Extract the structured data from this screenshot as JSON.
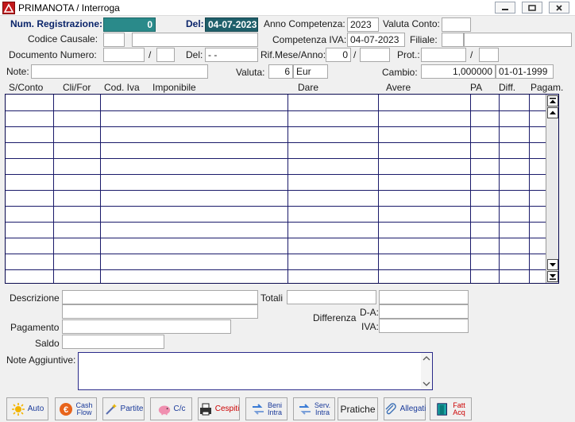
{
  "window": {
    "title": "PRIMANOTA / Interroga"
  },
  "header": {
    "num_registrazione_label": "Num. Registrazione:",
    "num_registrazione_value": "0",
    "del_label": "Del:",
    "del_value": "04-07-2023",
    "anno_competenza_label": "Anno Competenza:",
    "anno_competenza_value": "2023",
    "valuta_conto_label": "Valuta Conto:",
    "valuta_conto_value": "",
    "codice_causale_label": "Codice Causale:",
    "codice_causale_code": "",
    "codice_causale_desc": "",
    "competenza_iva_label": "Competenza IVA:",
    "competenza_iva_value": "04-07-2023",
    "filiale_label": "Filiale:",
    "filiale_code": "",
    "filiale_desc": "",
    "documento_numero_label": "Documento Numero:",
    "documento_numero_value": "",
    "documento_sep": "/",
    "documento_suffix": "",
    "doc_del_label": "Del:",
    "doc_del_value": "- -",
    "rif_mese_anno_label": "Rif.Mese/Anno:",
    "rif_mese_value": "0",
    "rif_sep": "/",
    "rif_anno_value": "",
    "prot_label": "Prot.:",
    "prot_value": "",
    "prot_sep": "/",
    "prot_suffix": "",
    "note_label": "Note:",
    "note_value": "",
    "valuta_label": "Valuta:",
    "valuta_code": "6",
    "valuta_name": "Eur",
    "cambio_label": "Cambio:",
    "cambio_value": "1,000000",
    "cambio_date": "01-01-1999"
  },
  "grid": {
    "columns": [
      "S/Conto",
      "Cli/For",
      "Cod. Iva",
      "Imponibile",
      "Dare",
      "Avere",
      "PA",
      "Diff.",
      "Pagam."
    ],
    "row_count": 12
  },
  "footer": {
    "descrizione_label": "Descrizione",
    "descrizione_1": "",
    "descrizione_2": "",
    "totali_label": "Totali",
    "totali_dare": "",
    "totali_avere": "",
    "differenza_label": "Differenza",
    "da_label": "D-A:",
    "da_value": "",
    "iva_label": "IVA:",
    "iva_value": "",
    "pagamento_label": "Pagamento",
    "pagamento_value": "",
    "saldo_label": "Saldo",
    "saldo_value": "",
    "note_aggiuntive_label": "Note Aggiuntive:",
    "note_aggiuntive_value": ""
  },
  "toolbar": {
    "auto": "Auto",
    "cash_flow_1": "Cash",
    "cash_flow_2": "Flow",
    "partite": "Partite",
    "cc": "C/c",
    "cespiti": "Cespiti",
    "beni_1": "Beni",
    "beni_2": "Intra",
    "serv_1": "Serv.",
    "serv_2": "Intra",
    "pratiche": "Pratiche",
    "allegati": "Allegati",
    "fatt_1": "Fatt",
    "fatt_2": "Acq"
  }
}
